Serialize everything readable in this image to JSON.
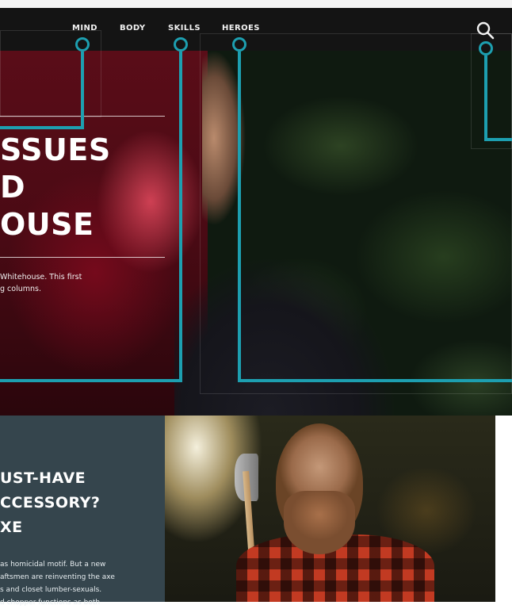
{
  "nav": {
    "items": [
      {
        "label": "MIND"
      },
      {
        "label": "BODY"
      },
      {
        "label": "SKILLS"
      },
      {
        "label": "HEROES"
      }
    ],
    "search_icon": "search-icon"
  },
  "hero": {
    "title_lines": [
      "SSUES",
      "D",
      "OUSE"
    ],
    "description_lines": [
      "Whitehouse. This first",
      "g columns."
    ]
  },
  "feature": {
    "title_lines": [
      "UST-HAVE",
      "CCESSORY?",
      "XE"
    ],
    "body_lines": [
      "as homicidal motif. But a new",
      "aftsmen are reinventing the axe",
      "s and closet lumber-sexuals.",
      "d chopper functions as both"
    ]
  },
  "colors": {
    "nav_bg": "#141414",
    "annotation_cyan": "#1d9fb0",
    "feature_panel_bg": "#35454d"
  }
}
